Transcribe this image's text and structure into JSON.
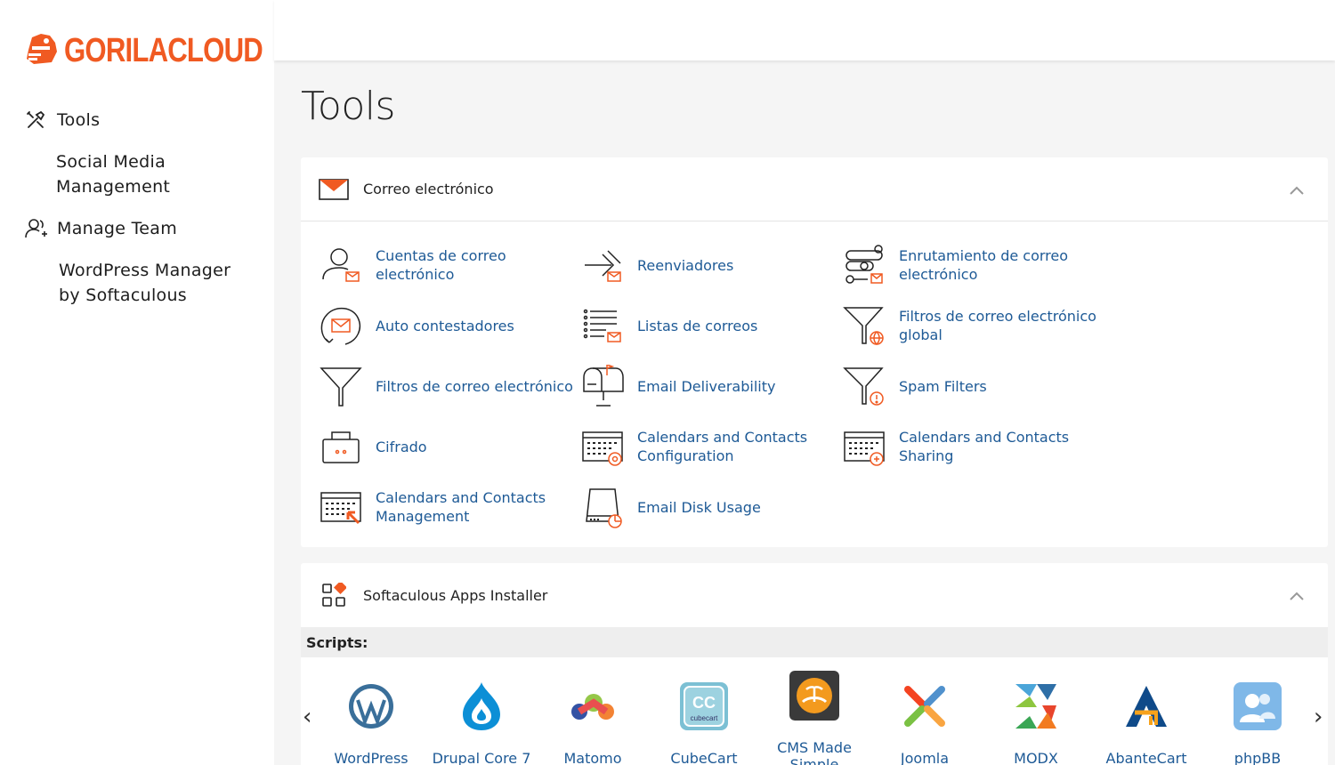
{
  "brand": {
    "name": "GORILACLOUD",
    "accent": "#f05a22"
  },
  "sidebar": {
    "items": [
      {
        "label": "Tools",
        "icon": "tools-icon"
      },
      {
        "label": "Social Media Management",
        "line1": "Social Media",
        "line2": "Management"
      },
      {
        "label": "Manage Team",
        "icon": "team-icon"
      },
      {
        "label": "WordPress Manager by Softaculous",
        "line1": "WordPress Manager",
        "line2": "by Softaculous"
      }
    ]
  },
  "page": {
    "title": "Tools"
  },
  "email_panel": {
    "title": "Correo electrónico",
    "icon": "envelope-icon",
    "tools": [
      {
        "l1": "Cuentas de correo",
        "l2": "electrónico",
        "icon": "email-accounts-icon"
      },
      {
        "l1": "Reenviadores",
        "l2": "",
        "icon": "forwarders-icon"
      },
      {
        "l1": "Enrutamiento de correo",
        "l2": "electrónico",
        "icon": "email-routing-icon"
      },
      {
        "l1": "Auto contestadores",
        "l2": "",
        "icon": "autoresponder-icon"
      },
      {
        "l1": "Listas de correos",
        "l2": "",
        "icon": "mailing-lists-icon"
      },
      {
        "l1": "Filtros de correo electrónico",
        "l2": "global",
        "icon": "global-filter-icon"
      },
      {
        "l1": "Filtros de correo electrónico",
        "l2": "",
        "icon": "filter-icon"
      },
      {
        "l1": "Email Deliverability",
        "l2": "",
        "icon": "mailbox-icon"
      },
      {
        "l1": "Spam Filters",
        "l2": "",
        "icon": "spam-filter-icon"
      },
      {
        "l1": "Cifrado",
        "l2": "",
        "icon": "encryption-icon"
      },
      {
        "l1": "Calendars and Contacts",
        "l2": "Configuration",
        "icon": "calendar-config-icon"
      },
      {
        "l1": "Calendars and Contacts",
        "l2": "Sharing",
        "icon": "calendar-sharing-icon"
      },
      {
        "l1": "Calendars and Contacts",
        "l2": "Management",
        "icon": "calendar-management-icon"
      },
      {
        "l1": "Email Disk Usage",
        "l2": "",
        "icon": "disk-usage-icon"
      }
    ]
  },
  "softaculous_panel": {
    "title": "Softaculous Apps Installer",
    "icon": "apps-grid-icon",
    "scripts_label": "Scripts:",
    "apps": [
      {
        "l1": "WordPress",
        "l2": "",
        "icon": "wordpress-icon"
      },
      {
        "l1": "Drupal Core 7",
        "l2": "",
        "icon": "drupal-icon"
      },
      {
        "l1": "Matomo",
        "l2": "",
        "icon": "matomo-icon"
      },
      {
        "l1": "CubeCart",
        "l2": "",
        "icon": "cubecart-icon"
      },
      {
        "l1": "CMS Made",
        "l2": "Simple",
        "icon": "cms-made-simple-icon"
      },
      {
        "l1": "Joomla",
        "l2": "",
        "icon": "joomla-icon"
      },
      {
        "l1": "MODX",
        "l2": "",
        "icon": "modx-icon"
      },
      {
        "l1": "AbanteCart",
        "l2": "",
        "icon": "abantecart-icon"
      },
      {
        "l1": "phpBB",
        "l2": "",
        "icon": "phpbb-icon"
      }
    ]
  }
}
